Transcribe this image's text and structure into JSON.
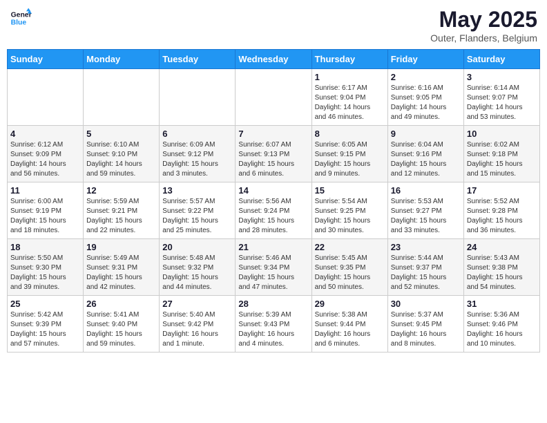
{
  "header": {
    "logo_line1": "General",
    "logo_line2": "Blue",
    "month_year": "May 2025",
    "location": "Outer, Flanders, Belgium"
  },
  "weekdays": [
    "Sunday",
    "Monday",
    "Tuesday",
    "Wednesday",
    "Thursday",
    "Friday",
    "Saturday"
  ],
  "weeks": [
    [
      {
        "day": "",
        "info": ""
      },
      {
        "day": "",
        "info": ""
      },
      {
        "day": "",
        "info": ""
      },
      {
        "day": "",
        "info": ""
      },
      {
        "day": "1",
        "info": "Sunrise: 6:17 AM\nSunset: 9:04 PM\nDaylight: 14 hours\nand 46 minutes."
      },
      {
        "day": "2",
        "info": "Sunrise: 6:16 AM\nSunset: 9:05 PM\nDaylight: 14 hours\nand 49 minutes."
      },
      {
        "day": "3",
        "info": "Sunrise: 6:14 AM\nSunset: 9:07 PM\nDaylight: 14 hours\nand 53 minutes."
      }
    ],
    [
      {
        "day": "4",
        "info": "Sunrise: 6:12 AM\nSunset: 9:09 PM\nDaylight: 14 hours\nand 56 minutes."
      },
      {
        "day": "5",
        "info": "Sunrise: 6:10 AM\nSunset: 9:10 PM\nDaylight: 14 hours\nand 59 minutes."
      },
      {
        "day": "6",
        "info": "Sunrise: 6:09 AM\nSunset: 9:12 PM\nDaylight: 15 hours\nand 3 minutes."
      },
      {
        "day": "7",
        "info": "Sunrise: 6:07 AM\nSunset: 9:13 PM\nDaylight: 15 hours\nand 6 minutes."
      },
      {
        "day": "8",
        "info": "Sunrise: 6:05 AM\nSunset: 9:15 PM\nDaylight: 15 hours\nand 9 minutes."
      },
      {
        "day": "9",
        "info": "Sunrise: 6:04 AM\nSunset: 9:16 PM\nDaylight: 15 hours\nand 12 minutes."
      },
      {
        "day": "10",
        "info": "Sunrise: 6:02 AM\nSunset: 9:18 PM\nDaylight: 15 hours\nand 15 minutes."
      }
    ],
    [
      {
        "day": "11",
        "info": "Sunrise: 6:00 AM\nSunset: 9:19 PM\nDaylight: 15 hours\nand 18 minutes."
      },
      {
        "day": "12",
        "info": "Sunrise: 5:59 AM\nSunset: 9:21 PM\nDaylight: 15 hours\nand 22 minutes."
      },
      {
        "day": "13",
        "info": "Sunrise: 5:57 AM\nSunset: 9:22 PM\nDaylight: 15 hours\nand 25 minutes."
      },
      {
        "day": "14",
        "info": "Sunrise: 5:56 AM\nSunset: 9:24 PM\nDaylight: 15 hours\nand 28 minutes."
      },
      {
        "day": "15",
        "info": "Sunrise: 5:54 AM\nSunset: 9:25 PM\nDaylight: 15 hours\nand 30 minutes."
      },
      {
        "day": "16",
        "info": "Sunrise: 5:53 AM\nSunset: 9:27 PM\nDaylight: 15 hours\nand 33 minutes."
      },
      {
        "day": "17",
        "info": "Sunrise: 5:52 AM\nSunset: 9:28 PM\nDaylight: 15 hours\nand 36 minutes."
      }
    ],
    [
      {
        "day": "18",
        "info": "Sunrise: 5:50 AM\nSunset: 9:30 PM\nDaylight: 15 hours\nand 39 minutes."
      },
      {
        "day": "19",
        "info": "Sunrise: 5:49 AM\nSunset: 9:31 PM\nDaylight: 15 hours\nand 42 minutes."
      },
      {
        "day": "20",
        "info": "Sunrise: 5:48 AM\nSunset: 9:32 PM\nDaylight: 15 hours\nand 44 minutes."
      },
      {
        "day": "21",
        "info": "Sunrise: 5:46 AM\nSunset: 9:34 PM\nDaylight: 15 hours\nand 47 minutes."
      },
      {
        "day": "22",
        "info": "Sunrise: 5:45 AM\nSunset: 9:35 PM\nDaylight: 15 hours\nand 50 minutes."
      },
      {
        "day": "23",
        "info": "Sunrise: 5:44 AM\nSunset: 9:37 PM\nDaylight: 15 hours\nand 52 minutes."
      },
      {
        "day": "24",
        "info": "Sunrise: 5:43 AM\nSunset: 9:38 PM\nDaylight: 15 hours\nand 54 minutes."
      }
    ],
    [
      {
        "day": "25",
        "info": "Sunrise: 5:42 AM\nSunset: 9:39 PM\nDaylight: 15 hours\nand 57 minutes."
      },
      {
        "day": "26",
        "info": "Sunrise: 5:41 AM\nSunset: 9:40 PM\nDaylight: 15 hours\nand 59 minutes."
      },
      {
        "day": "27",
        "info": "Sunrise: 5:40 AM\nSunset: 9:42 PM\nDaylight: 16 hours\nand 1 minute."
      },
      {
        "day": "28",
        "info": "Sunrise: 5:39 AM\nSunset: 9:43 PM\nDaylight: 16 hours\nand 4 minutes."
      },
      {
        "day": "29",
        "info": "Sunrise: 5:38 AM\nSunset: 9:44 PM\nDaylight: 16 hours\nand 6 minutes."
      },
      {
        "day": "30",
        "info": "Sunrise: 5:37 AM\nSunset: 9:45 PM\nDaylight: 16 hours\nand 8 minutes."
      },
      {
        "day": "31",
        "info": "Sunrise: 5:36 AM\nSunset: 9:46 PM\nDaylight: 16 hours\nand 10 minutes."
      }
    ]
  ]
}
